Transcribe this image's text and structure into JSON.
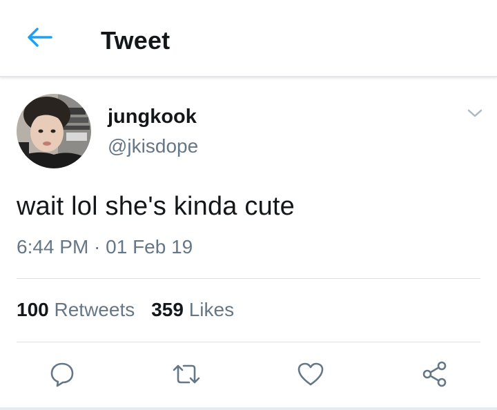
{
  "header": {
    "title": "Tweet",
    "back_icon": "arrow-left-icon"
  },
  "tweet": {
    "display_name": "jungkook",
    "handle": "@jkisdope",
    "text": "wait lol she's kinda cute",
    "timestamp": "6:44 PM · 01 Feb 19",
    "retweets_count": "100",
    "retweets_label": "Retweets",
    "likes_count": "359",
    "likes_label": "Likes"
  },
  "actions": [
    "reply-icon",
    "retweet-icon",
    "like-icon",
    "share-icon"
  ],
  "colors": {
    "accent": "#1da1f2",
    "secondary_text": "#657786",
    "icon": "#657786",
    "divider": "#dadfe3"
  }
}
